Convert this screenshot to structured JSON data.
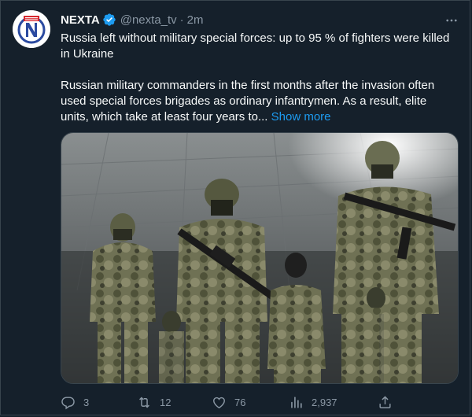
{
  "tweet": {
    "author_name": "NEXTA",
    "handle": "@nexta_tv",
    "separator": "·",
    "time": "2m",
    "headline": "Russia left without military special forces: up to 95 % of fighters were killed in Ukraine",
    "body": "Russian military commanders in the first months after the invasion often used special forces brigades as ordinary infantrymen. As a result, elite units, which take at least four years to...",
    "show_more": "Show more"
  },
  "icons": {
    "avatar": "nexta-logo-icon",
    "verified": "verified-badge-icon",
    "more": "more-dots-icon",
    "reply": "reply-icon",
    "retweet": "retweet-icon",
    "like": "heart-icon",
    "views": "views-chart-icon",
    "share": "share-icon"
  },
  "metrics": {
    "replies": "3",
    "retweets": "12",
    "likes": "76",
    "views": "2,937"
  },
  "colors": {
    "background": "#15202b",
    "text": "#f7f9f9",
    "secondary": "#8b98a5",
    "accent": "#1d9bf0",
    "brand_red": "#d7282f"
  }
}
